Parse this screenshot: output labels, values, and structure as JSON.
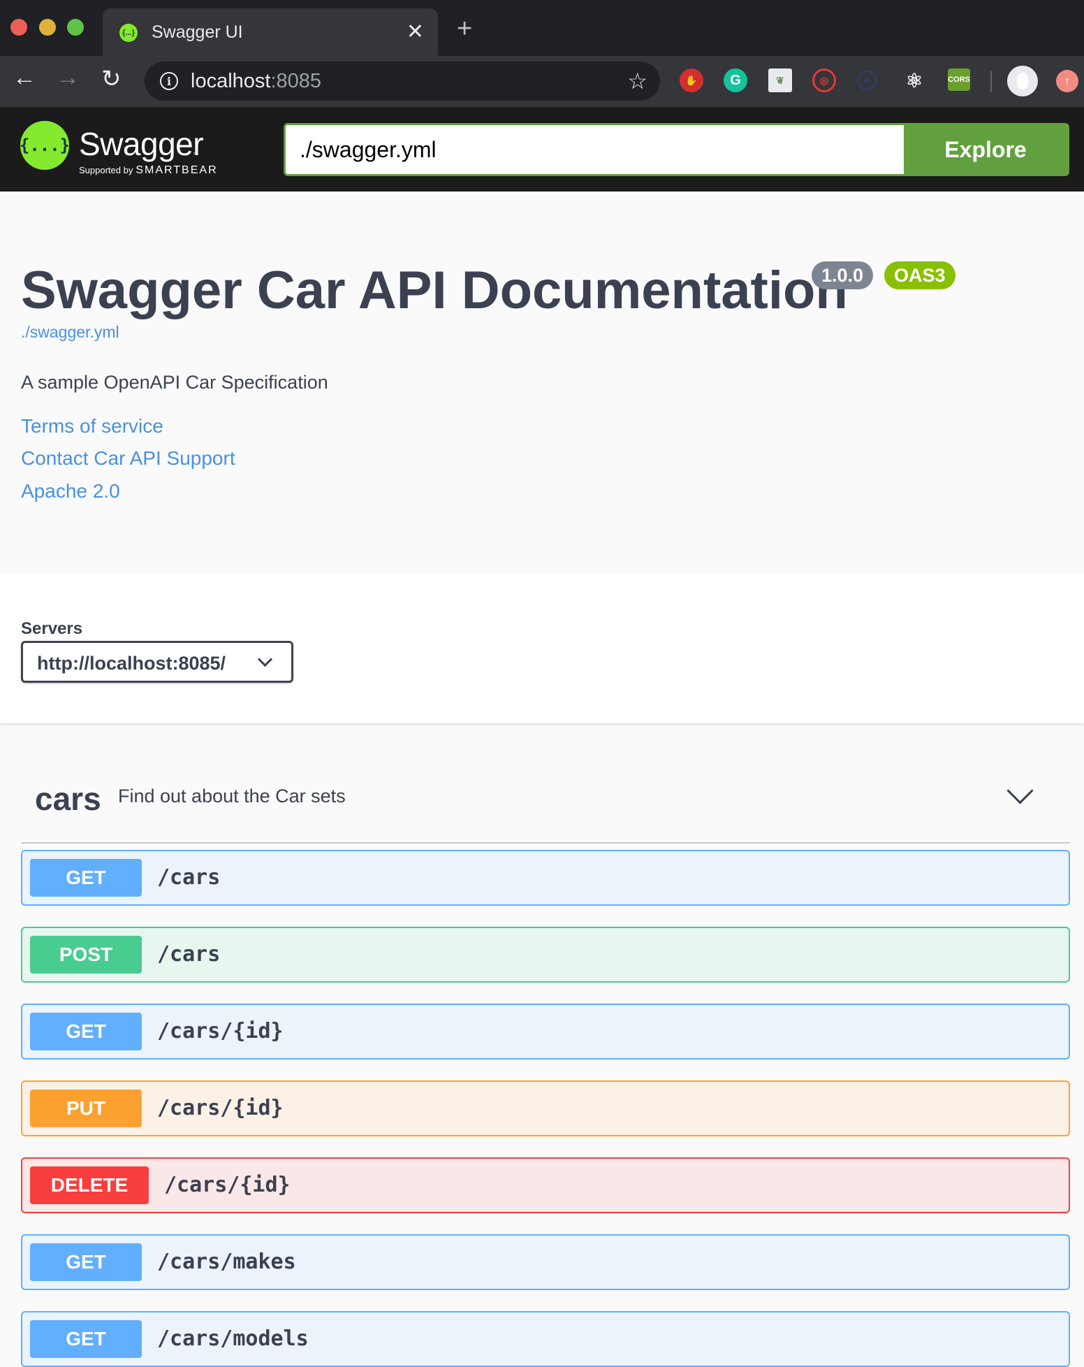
{
  "browser": {
    "tab_title": "Swagger UI",
    "tab_favicon": "{...}",
    "close_glyph": "✕",
    "new_tab_glyph": "+",
    "back_glyph": "←",
    "forward_glyph": "→",
    "reload_glyph": "↻",
    "url_host": "localhost",
    "url_port": ":8085",
    "star_glyph": "☆",
    "extensions": [
      "✋",
      "G",
      "❦",
      "◎",
      "A",
      "⚛",
      "CORS"
    ]
  },
  "topbar": {
    "logo_text": "Swagger",
    "logo_mark": "{...}",
    "tm": "™",
    "supported_by": "Supported by",
    "smartbear": "SMARTBEAR",
    "url_value": "./swagger.yml",
    "explore_label": "Explore",
    "accent_color": "#62a03f"
  },
  "info": {
    "title": "Swagger Car API Documentation",
    "version": "1.0.0",
    "oas": "OAS3",
    "spec_link": "./swagger.yml",
    "description": "A sample OpenAPI Car Specification",
    "links": [
      "Terms of service",
      "Contact Car API Support",
      "Apache 2.0"
    ]
  },
  "servers": {
    "label": "Servers",
    "selected": "http://localhost:8085/"
  },
  "tag": {
    "name": "cars",
    "description": "Find out about the Car sets"
  },
  "operations": [
    {
      "method": "GET",
      "path": "/cars",
      "color": "#61affe"
    },
    {
      "method": "POST",
      "path": "/cars",
      "color": "#49cc90"
    },
    {
      "method": "GET",
      "path": "/cars/{id}",
      "color": "#61affe"
    },
    {
      "method": "PUT",
      "path": "/cars/{id}",
      "color": "#fca130"
    },
    {
      "method": "DELETE",
      "path": "/cars/{id}",
      "color": "#f93e3e"
    },
    {
      "method": "GET",
      "path": "/cars/makes",
      "color": "#61affe"
    },
    {
      "method": "GET",
      "path": "/cars/models",
      "color": "#61affe"
    }
  ]
}
